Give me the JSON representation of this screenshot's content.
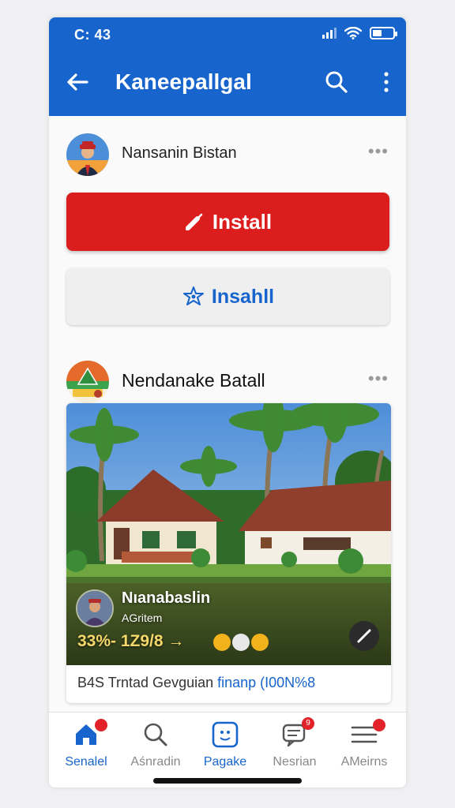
{
  "status_bar": {
    "time": "C: 43"
  },
  "app_bar": {
    "title": "Kaneepallgal",
    "icons": [
      "back-arrow-icon",
      "search-icon",
      "more-vert-icon"
    ]
  },
  "post1": {
    "author": "Nansanin Bistan",
    "menu": "•••"
  },
  "actions": {
    "install_primary": "Install",
    "install_secondary": "Insahll"
  },
  "post2": {
    "author": "Nendanake Batall",
    "menu": "•••",
    "overlay_name": "Nıanabaslin",
    "overlay_sub": "AGritem",
    "overlay_stats": "33%- 1Z9/8 →",
    "caption_text": "B4S Trntad Gevguian ",
    "caption_link": "finanp",
    "caption_extra": " (I00N%8"
  },
  "bottom_nav": [
    {
      "label": "Senalel",
      "icon": "home-icon",
      "active": true
    },
    {
      "label": "Aśnradin",
      "icon": "search-icon",
      "active": false
    },
    {
      "label": "Pagake",
      "icon": "pages-icon",
      "active": false
    },
    {
      "label": "Nesrian",
      "icon": "messages-icon",
      "active": false,
      "badge": "9"
    },
    {
      "label": "AMeirns",
      "icon": "menu-icon",
      "active": false
    }
  ],
  "colors": {
    "brand_blue": "#1764cc",
    "install_red": "#dc1d1d"
  }
}
